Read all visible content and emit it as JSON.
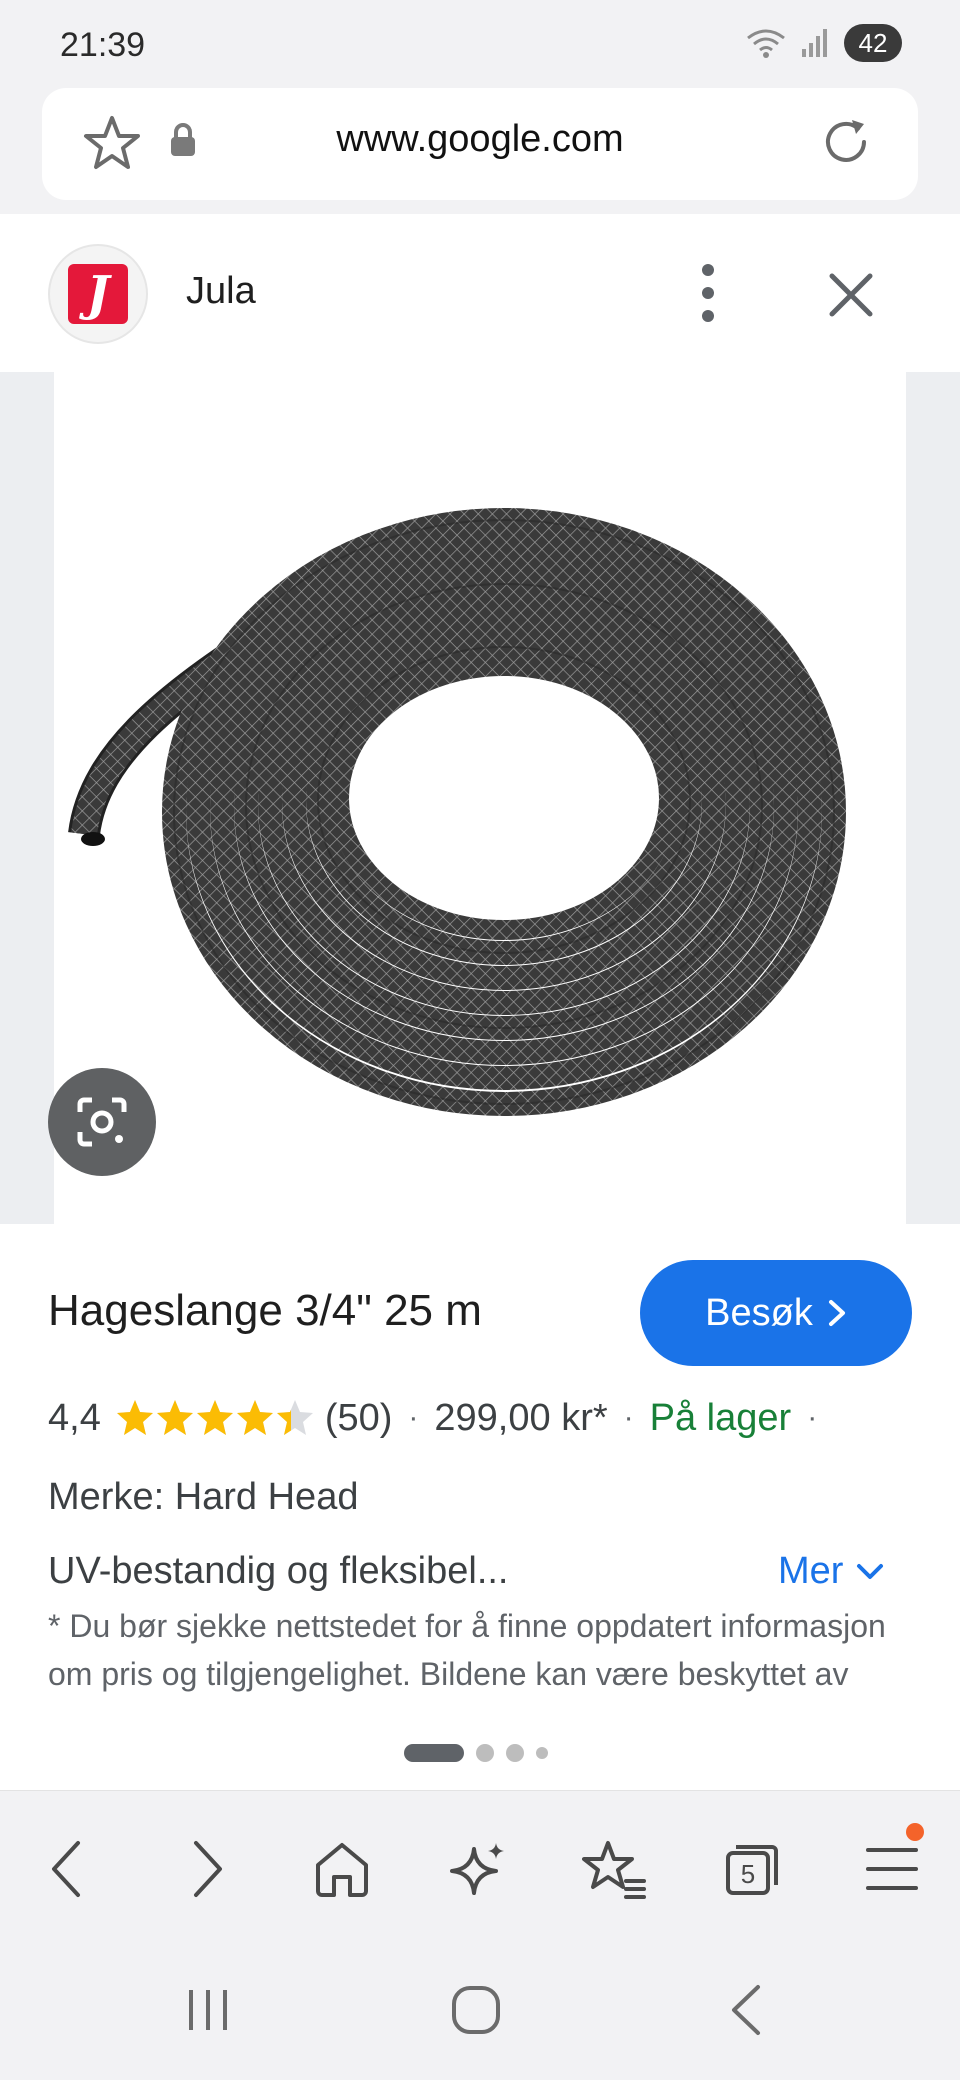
{
  "status_bar": {
    "time": "21:39",
    "battery": "42",
    "icons": [
      "wifi-icon",
      "signal-icon",
      "battery-icon"
    ]
  },
  "browser": {
    "url": "www.google.com",
    "icons": [
      "star-icon",
      "lock-icon",
      "reload-icon"
    ]
  },
  "sheet": {
    "site_name": "Jula",
    "site_logo_letter": "J",
    "brand_color": "#e4183a"
  },
  "product": {
    "title": "Hageslange 3/4\" 25 m",
    "visit_label": "Besøk",
    "rating_value": "4,4",
    "rating_fraction": 0.88,
    "star_count": 5,
    "review_count": "(50)",
    "price": "299,00 kr*",
    "stock": "På lager",
    "separator": "·",
    "brand_line": "Merke: Hard Head",
    "description": "UV-bestandig og fleksibel...",
    "more_label": "Mer",
    "disclaimer": "* Du bør sjekke nettstedet for å finne oppdatert informasjon om pris og tilgjengelighet. Bildene kan være beskyttet av opphavsrett. Finn ut mer"
  },
  "carousel": {
    "pages": 4,
    "active_index": 0
  },
  "toolbar": {
    "tabs_count": "5",
    "items": [
      "back-icon",
      "forward-icon",
      "home-icon",
      "sparkle-icon",
      "bookmarks-icon",
      "tabs-icon",
      "menu-icon"
    ]
  },
  "colors": {
    "accent": "#1a73e8",
    "in_stock": "#188038",
    "star": "#fbbc04",
    "notification": "#f4632a"
  }
}
